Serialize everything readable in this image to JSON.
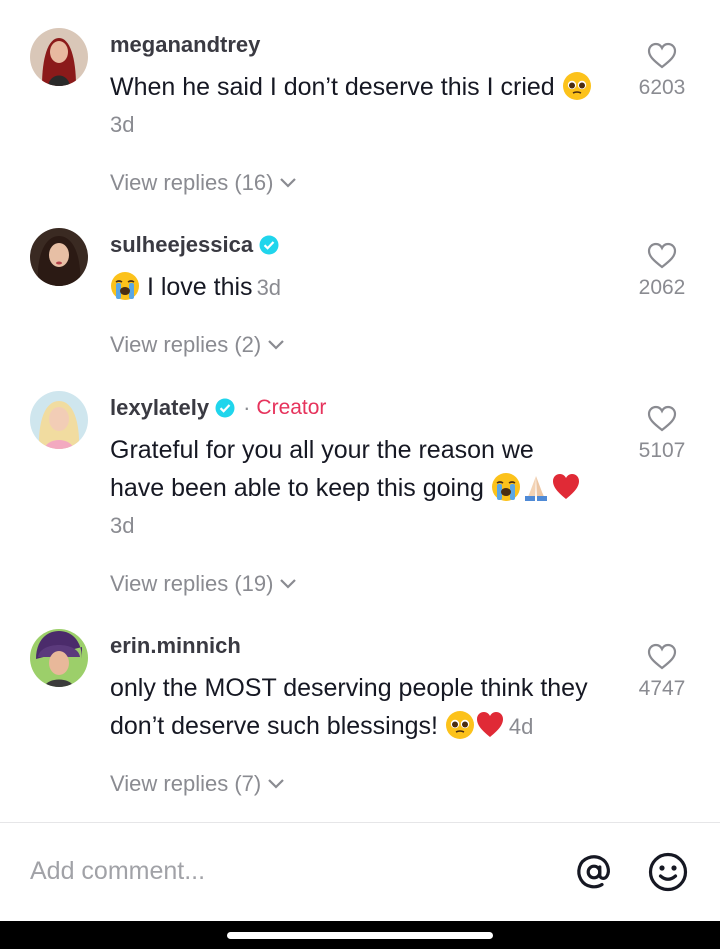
{
  "comments": [
    {
      "username": "meganandtrey",
      "text": "When he said I don’t deserve this I cried",
      "time": "3d",
      "likes": "6203",
      "replies": "View replies (16)",
      "emoji": [
        "pleading-face-emoji"
      ]
    },
    {
      "username": "sulheejessica",
      "verified": true,
      "text": "I love this",
      "time": "3d",
      "likes": "2062",
      "replies": "View replies (2)",
      "emoji": [
        "loudly-crying-face-emoji"
      ]
    },
    {
      "username": "lexylately",
      "verified": true,
      "separator": "·",
      "badge": "Creator",
      "text_line1": "Grateful for you all your the reason we",
      "text_line2": "have been able to keep this going",
      "time": "3d",
      "likes": "5107",
      "replies": "View replies (19)",
      "emoji": [
        "loudly-crying-face-emoji",
        "folded-hands-emoji",
        "red-heart-emoji"
      ]
    },
    {
      "username": "erin.minnich",
      "text_line1": "only the MOST deserving people think they",
      "text_line2": "don’t deserve such blessings!",
      "time": "4d",
      "likes": "4747",
      "replies": "View replies (7)",
      "emoji": [
        "pleading-face-emoji",
        "red-heart-emoji"
      ]
    }
  ],
  "composer": {
    "placeholder": "Add comment...",
    "mention_icon": "at-sign-icon",
    "emoji_icon": "smiley-face-icon"
  },
  "colors": {
    "text": "#161823",
    "muted": "#8a8b91",
    "creator": "#e6335c",
    "verified": "#20d5ec",
    "heart": "#e02a36"
  }
}
